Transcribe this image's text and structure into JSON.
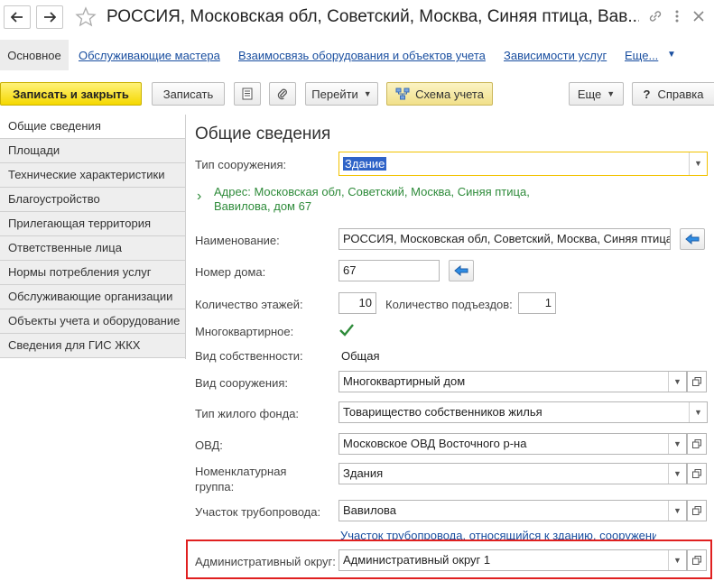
{
  "window": {
    "title": "РОССИЯ, Московская обл, Советский, Москва, Синяя птица, Вав..."
  },
  "tabs": {
    "main": "Основное",
    "links": [
      "Обслуживающие мастера",
      "Взаимосвязь оборудования и объектов учета",
      "Зависимости услуг",
      "Еще..."
    ]
  },
  "toolbar": {
    "save_close": "Записать и закрыть",
    "save": "Записать",
    "goto": "Перейти",
    "schema": "Схема учета",
    "more": "Еще",
    "help": "Справка",
    "help_mark": "?"
  },
  "sidebar": {
    "items": [
      "Общие сведения",
      "Площади",
      "Технические характеристики",
      "Благоустройство",
      "Прилегающая территория",
      "Ответственные лица",
      "Нормы потребления услуг",
      "Обслуживающие организации",
      "Объекты учета и оборудование",
      "Сведения для ГИС ЖКХ"
    ]
  },
  "form": {
    "heading": "Общие сведения",
    "type_label": "Тип сооружения:",
    "type_value": "Здание",
    "address_line1": "Адрес: Московская обл, Советский, Москва, Синяя птица,",
    "address_line2": "Вавилова, дом 67",
    "name_label": "Наименование:",
    "name_value": "РОССИЯ, Московская обл, Советский, Москва, Синяя птица",
    "house_label": "Номер дома:",
    "house_value": "67",
    "floors_label": "Количество этажей:",
    "floors_value": "10",
    "entrances_label": "Количество подъездов:",
    "entrances_value": "1",
    "multi_label": "Многоквартирное:",
    "ownership_label": "Вид собственности:",
    "ownership_value": "Общая",
    "kind_label": "Вид сооружения:",
    "kind_value": "Многоквартирный дом",
    "fund_label": "Тип жилого фонда:",
    "fund_value": "Товарищество собственников жилья",
    "ovd_label": "ОВД:",
    "ovd_value": "Московское ОВД Восточного р-на",
    "nomen_label_1": "Номенклатурная",
    "nomen_label_2": "группа:",
    "nomen_value": "Здания",
    "pipe_label": "Участок трубопровода:",
    "pipe_value": "Вавилова",
    "pipe_hint": "Участок трубопровода, относящийся к зданию, сооружению",
    "district_label": "Административный округ:",
    "district_value": "Административный округ 1"
  },
  "colors": {
    "accent_yellow": "#f5d800",
    "link_blue": "#1a4fa0",
    "address_green": "#2e8b3a",
    "highlight_red": "#e02020"
  }
}
